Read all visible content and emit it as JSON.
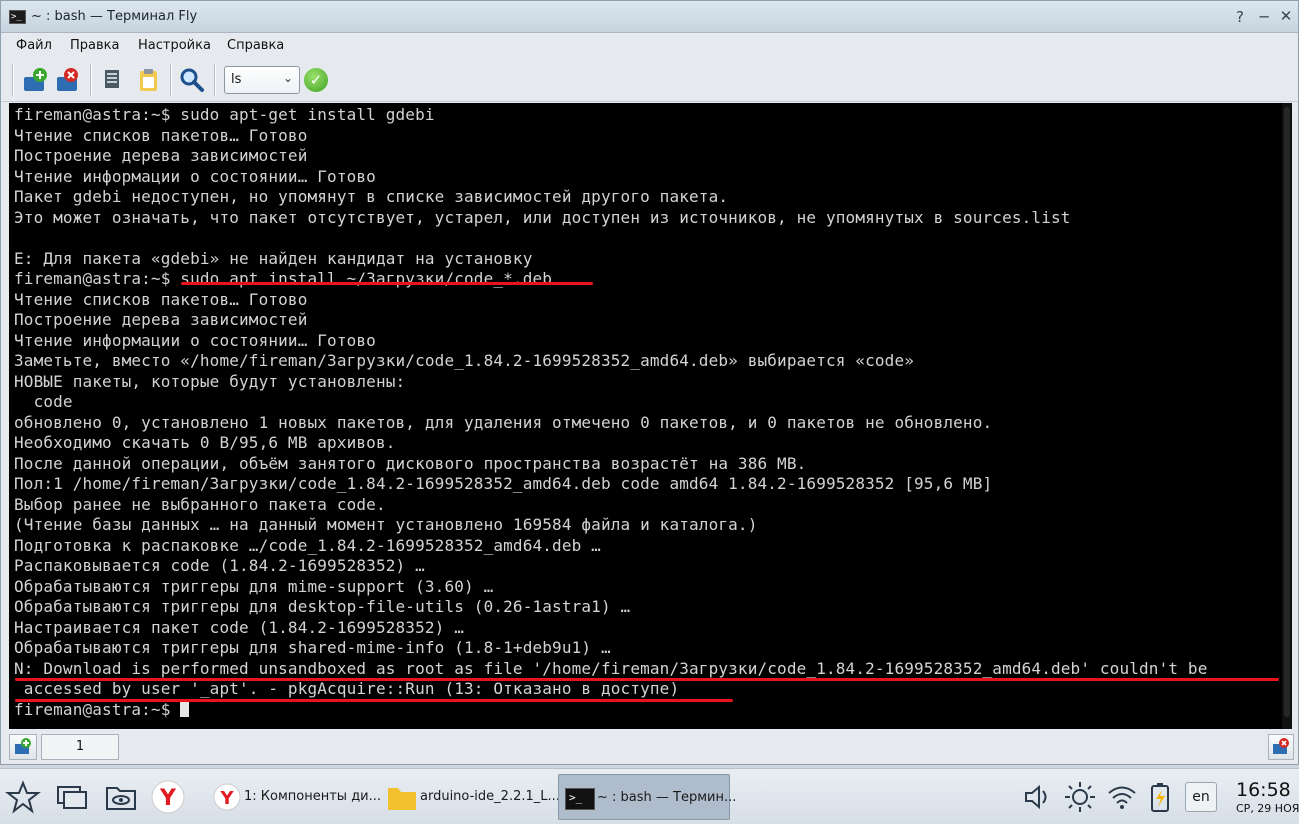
{
  "window": {
    "title": "~ : bash — Терминал Fly"
  },
  "menu": [
    "Файл",
    "Правка",
    "Настройка",
    "Справка"
  ],
  "toolbar": {
    "command_value": "ls"
  },
  "terminal": {
    "lines": [
      "fireman@astra:~$ sudo apt-get install gdebi",
      "Чтение списков пакетов… Готово",
      "Построение дерева зависимостей",
      "Чтение информации о состоянии… Готово",
      "Пакет gdebi недоступен, но упомянут в списке зависимостей другого пакета.",
      "Это может означать, что пакет отсутствует, устарел, или доступен из источников, не упомянутых в sources.list",
      "",
      "E: Для пакета «gdebi» не найден кандидат на установку",
      "fireman@astra:~$ sudo apt install ~/Загрузки/code_*.deb",
      "Чтение списков пакетов… Готово",
      "Построение дерева зависимостей",
      "Чтение информации о состоянии… Готово",
      "Заметьте, вместо «/home/fireman/Загрузки/code_1.84.2-1699528352_amd64.deb» выбирается «code»",
      "НОВЫЕ пакеты, которые будут установлены:",
      "  code",
      "обновлено 0, установлено 1 новых пакетов, для удаления отмечено 0 пакетов, и 0 пакетов не обновлено.",
      "Необходимо скачать 0 B/95,6 MB архивов.",
      "После данной операции, объём занятого дискового пространства возрастёт на 386 MB.",
      "Пол:1 /home/fireman/Загрузки/code_1.84.2-1699528352_amd64.deb code amd64 1.84.2-1699528352 [95,6 MB]",
      "Выбор ранее не выбранного пакета code.",
      "(Чтение базы данных … на данный момент установлено 169584 файла и каталога.)",
      "Подготовка к распаковке …/code_1.84.2-1699528352_amd64.deb …",
      "Распаковывается code (1.84.2-1699528352) …",
      "Обрабатываются триггеры для mime-support (3.60) …",
      "Обрабатываются триггеры для desktop-file-utils (0.26-1astra1) …",
      "Настраивается пакет code (1.84.2-1699528352) …",
      "Обрабатываются триггеры для shared-mime-info (1.8-1+deb9u1) …",
      "N: Download is performed unsandboxed as root as file '/home/fireman/Загрузки/code_1.84.2-1699528352_amd64.deb' couldn't be",
      " accessed by user '_apt'. - pkgAcquire::Run (13: Отказано в доступе)"
    ],
    "prompt": "fireman@astra:~$ "
  },
  "tabs": {
    "active_label": "1"
  },
  "taskbar": {
    "tasks": [
      "1: Компоненты ди...",
      "arduino-ide_2.2.1_L...",
      "~ : bash — Термин..."
    ],
    "language": "en",
    "time": "16:58",
    "date": "СР, 29 НОЯ"
  }
}
